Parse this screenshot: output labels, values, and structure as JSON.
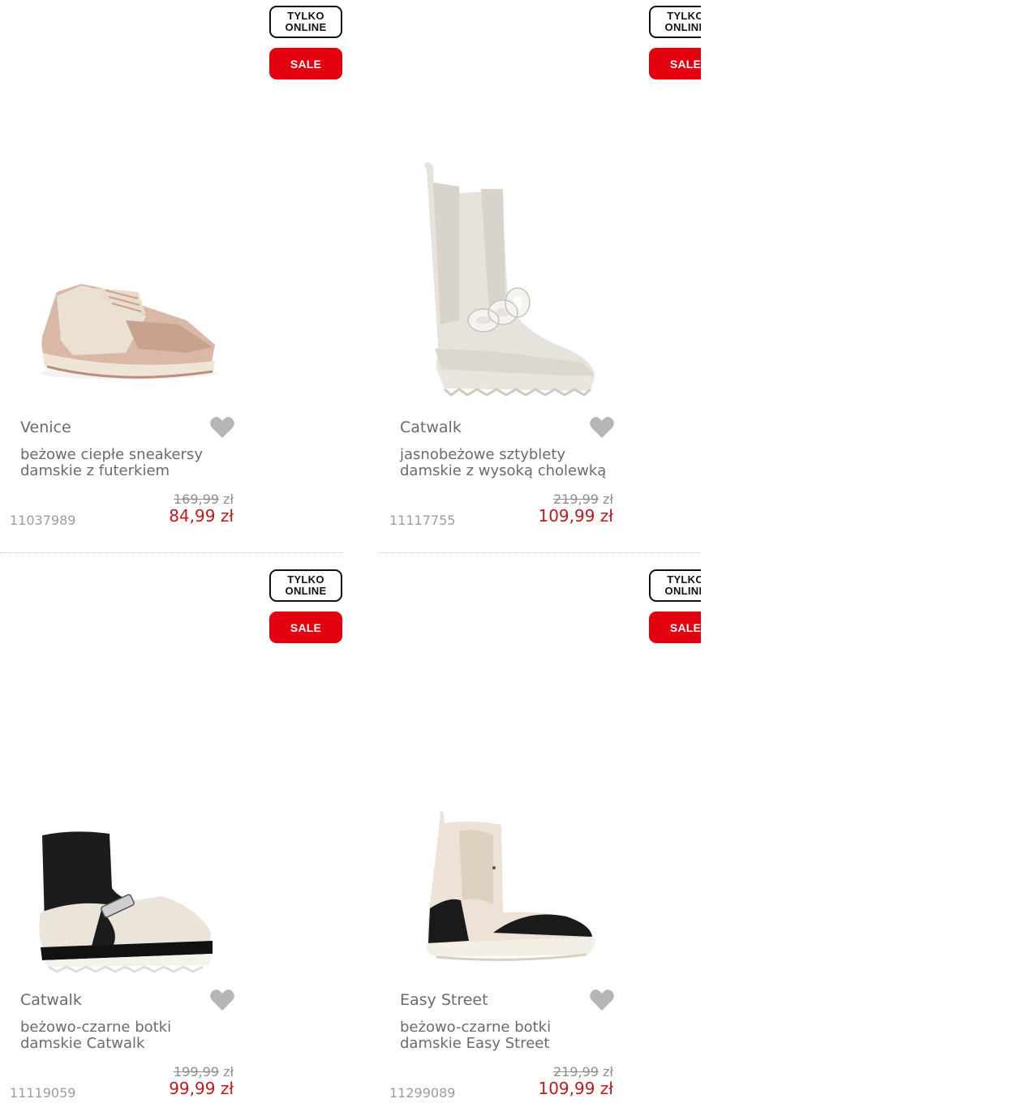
{
  "badges": {
    "online": "TYLKO ONLINE",
    "online_line1": "TYLKO",
    "online_line2": "ONLINE",
    "sale": "SALE"
  },
  "products": [
    {
      "brand": "Venice",
      "name_line1": "beżowe ciepłe sneakersy",
      "name_line2": "damskie z futerkiem",
      "price_old": "169,99",
      "currency_old": "zł",
      "price_new": "84,99 zł",
      "sku": "11037989",
      "image_icon": "sneaker-image"
    },
    {
      "brand": "Catwalk",
      "name_line1": "jasnobeżowe sztyblety",
      "name_line2": "damskie z wysoką cholewką",
      "price_old": "219,99",
      "currency_old": "zł",
      "price_new": "109,99 zł",
      "sku": "11117755",
      "image_icon": "tall-boot-image"
    },
    {
      "brand": "Catwalk",
      "name_line1": "beżowo-czarne botki",
      "name_line2": "damskie Catwalk",
      "price_old": "199,99",
      "currency_old": "zł",
      "price_new": "99,99 zł",
      "sku": "11119059",
      "image_icon": "sock-boot-image"
    },
    {
      "brand": "Easy Street",
      "name_line1": "beżowo-czarne botki",
      "name_line2": "damskie Easy Street",
      "price_old": "219,99",
      "currency_old": "zł",
      "price_new": "109,99 zł",
      "sku": "11299089",
      "image_icon": "ankle-boot-image"
    }
  ],
  "colors": {
    "sale_red": "#e3000f",
    "price_red": "#c6171b",
    "text_gray": "#6b6b6b",
    "heart_gray": "#b5b5b5"
  }
}
